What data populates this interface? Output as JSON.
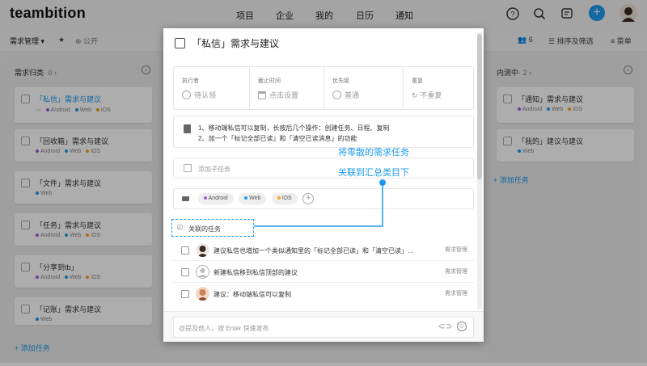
{
  "app": {
    "logo": "teambition",
    "nav": [
      "项目",
      "企业",
      "我的",
      "日历",
      "通知"
    ],
    "plus": "+"
  },
  "subbar": {
    "project": "需求管理",
    "visibility": "公开",
    "members": "6",
    "sort": "排序及筛选",
    "menu": "菜单"
  },
  "columns": [
    {
      "name": "需求归类",
      "count": "· 0",
      "cards": [
        {
          "title": "「私信」需求与建议",
          "blue": true,
          "tags": [
            "Android",
            "Web",
            "iOS"
          ]
        },
        {
          "title": "「回收箱」需求与建议",
          "blue": false,
          "tags": [
            "Android",
            "Web",
            "iOS"
          ]
        },
        {
          "title": "「文件」需求与建议",
          "blue": false,
          "tags": [
            "Web"
          ]
        },
        {
          "title": "「任务」需求与建议",
          "blue": false,
          "tags": [
            "Android",
            "Web",
            "iOS"
          ]
        },
        {
          "title": "「分享到tb」",
          "blue": false,
          "tags": [
            "Android",
            "Web",
            "iOS"
          ]
        },
        {
          "title": "「记账」需求与建议",
          "blue": false,
          "tags": [
            "Web"
          ]
        }
      ],
      "add_task": "+ 添加任务"
    },
    {
      "name": "内测中",
      "count": "· 2",
      "cards": [
        {
          "title": "「通知」需求与建议",
          "blue": false,
          "tags": [
            "Android",
            "Web",
            "iOS"
          ]
        },
        {
          "title": "「我的」建议与建议",
          "blue": false,
          "tags": [
            "Web"
          ]
        }
      ],
      "add_task": "+ 添加任务"
    }
  ],
  "tag_colors": {
    "Android": "#a15cd6",
    "Web": "#1b9aee",
    "iOS": "#f5a623"
  },
  "modal": {
    "title": "「私信」需求与建议",
    "fields": [
      {
        "label": "执行者",
        "value": "待认领"
      },
      {
        "label": "截止时间",
        "value": "点击设置"
      },
      {
        "label": "优先级",
        "value": "普通"
      },
      {
        "label": "重复",
        "value": "不重复"
      }
    ],
    "desc_lines": [
      "1、移动端私信可以复制，长按后几个操作：创建任务、日程、复制",
      "2、加一个「标记全部已读」和「清空已读消息」的功能"
    ],
    "subtask_placeholder": "添加子任务",
    "tags": [
      "Android",
      "Web",
      "iOS"
    ],
    "related_label": "关联的任务",
    "related": [
      {
        "text": "建议私信也增加一个类似通知里的「标记全部已读」和「清空已读」…",
        "project": "需求管理"
      },
      {
        "text": "新建私信移到私信顶部的建议",
        "project": "需求管理"
      },
      {
        "text": "建议：移动端私信可以复制",
        "project": "需求管理"
      }
    ],
    "comment_placeholder": "@提及他人，按 Enter 快速发布"
  },
  "annotation": {
    "line1": "将零散的需求任务",
    "line2": "关联到汇总类目下"
  }
}
